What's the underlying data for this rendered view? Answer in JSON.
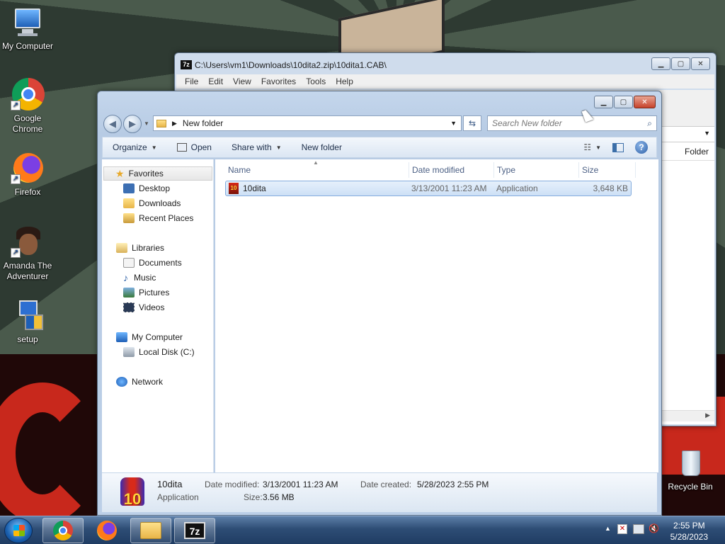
{
  "desktop": {
    "icons": [
      {
        "label": "My Computer"
      },
      {
        "label": "Google Chrome"
      },
      {
        "label": "Firefox"
      },
      {
        "label": "Amanda The Adventurer"
      },
      {
        "label": "setup"
      },
      {
        "label": "Recycle Bin"
      }
    ]
  },
  "zipwindow": {
    "title": "C:\\Users\\vm1\\Downloads\\10dita2.zip\\10dita1.CAB\\",
    "menu": [
      "File",
      "Edit",
      "View",
      "Favorites",
      "Tools",
      "Help"
    ],
    "column_visible": "Folder"
  },
  "explorer": {
    "address": "New folder",
    "search_placeholder": "Search New folder",
    "commands": {
      "organize": "Organize",
      "open": "Open",
      "share_with": "Share with",
      "new_folder": "New folder"
    },
    "nav": {
      "favorites": "Favorites",
      "desktop": "Desktop",
      "downloads": "Downloads",
      "recent_places": "Recent Places",
      "libraries": "Libraries",
      "documents": "Documents",
      "music": "Music",
      "pictures": "Pictures",
      "videos": "Videos",
      "my_computer": "My Computer",
      "local_disk": "Local Disk (C:)",
      "network": "Network"
    },
    "columns": {
      "name": "Name",
      "date_modified": "Date modified",
      "type": "Type",
      "size": "Size"
    },
    "files": [
      {
        "name": "10dita",
        "date_modified": "3/13/2001 11:23 AM",
        "type": "Application",
        "size": "3,648 KB"
      }
    ],
    "details": {
      "name": "10dita",
      "kind": "Application",
      "date_modified_label": "Date modified:",
      "date_modified": "3/13/2001 11:23 AM",
      "size_label": "Size:",
      "size": "3.56 MB",
      "date_created_label": "Date created:",
      "date_created": "5/28/2023 2:55 PM",
      "icon_text": "10"
    }
  },
  "taskbar": {
    "time": "2:55 PM",
    "date": "5/28/2023",
    "zip_label": "7z"
  }
}
